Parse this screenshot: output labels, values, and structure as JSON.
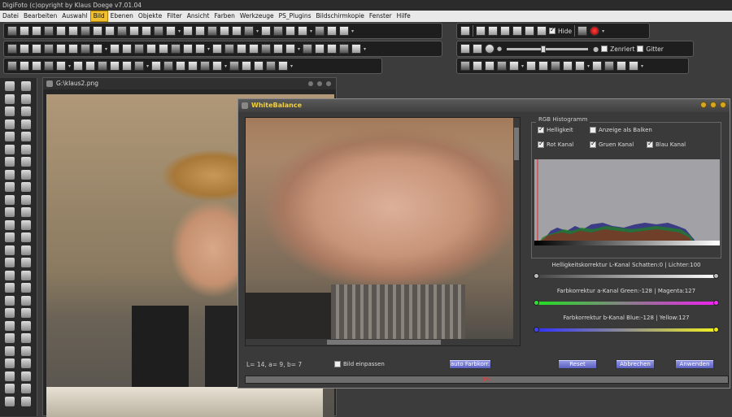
{
  "app": {
    "title": "DigiFoto (c)opyright by Klaus Doege v7.01.04"
  },
  "menu": [
    "Datei",
    "Bearbeiten",
    "Auswahl",
    "Bild",
    "Ebenen",
    "Objekte",
    "Filter",
    "Ansicht",
    "Farben",
    "Werkzeuge",
    "PS_Plugins",
    "Bildschirmkopie",
    "Fenster",
    "Hilfe"
  ],
  "menu_active": "Bild",
  "toolbar": {
    "hide_label": "Hide",
    "zentriert_label": "Zenriert",
    "gitter_label": "Gitter"
  },
  "document": {
    "title": "G:\\klaus2.png"
  },
  "dialog": {
    "title": "WhiteBalance",
    "histogram": {
      "legend": "RGB Histogramm",
      "helligkeit": "Helligkeit",
      "anzeige_balken": "Anzeige als Balken",
      "rot": "Rot Kanal",
      "gruen": "Gruen Kanal",
      "blau": "Blau Kanal"
    },
    "sliders": {
      "l_label": "Helligkeitskorrektur L-Kanal Schatten:0 | Lichter:100",
      "a_label": "Farbkorrektur a-Kanal Green:-128 | Magenta:127",
      "b_label": "Farbkorrektur b-Kanal Blue:-128 | Yellow:127"
    },
    "lab_readout": "L= 14,  a= 9,  b= 7",
    "fit_label": "Bild einpassen",
    "buttons": {
      "auto": "auto Farbkorr.",
      "reset": "Reset",
      "cancel": "Abbrechen",
      "apply": "Anwenden"
    },
    "progress_text": "0%",
    "progress_value": 0
  },
  "colors": {
    "accent": "#f0c030",
    "button": "#6a70d0",
    "progress_text": "#f03030"
  }
}
